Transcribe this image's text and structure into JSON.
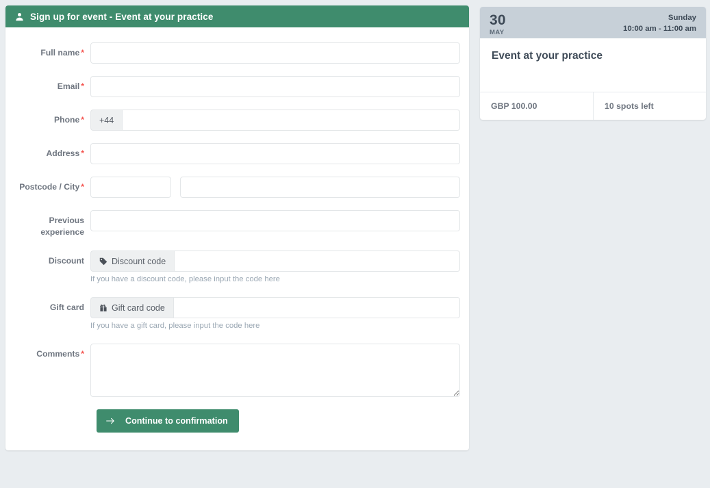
{
  "form": {
    "header": {
      "icon": "user-icon",
      "title": "Sign up for event - Event at your practice"
    },
    "fields": {
      "full_name": {
        "label": "Full name",
        "required": "*",
        "value": "",
        "placeholder": ""
      },
      "email": {
        "label": "Email",
        "required": "*",
        "value": "",
        "placeholder": ""
      },
      "phone": {
        "label": "Phone",
        "required": "*",
        "prefix": "+44",
        "value": "",
        "placeholder": ""
      },
      "address": {
        "label": "Address",
        "required": "*",
        "value": "",
        "placeholder": ""
      },
      "postcode_city": {
        "label": "Postcode / City",
        "required": "*",
        "postcode_value": "",
        "postcode_placeholder": "",
        "city_value": "",
        "city_placeholder": ""
      },
      "previous_experience": {
        "label": "Previous experience",
        "value": "",
        "placeholder": ""
      },
      "discount": {
        "label": "Discount",
        "addon_icon": "tag-icon",
        "addon_label": "Discount code",
        "value": "",
        "placeholder": "",
        "help": "If you have a discount code, please input the code here"
      },
      "gift_card": {
        "label": "Gift card",
        "addon_icon": "gift-icon",
        "addon_label": "Gift card code",
        "value": "",
        "placeholder": "",
        "help": "If you have a gift card, please input the code here"
      },
      "comments": {
        "label": "Comments",
        "required": "*",
        "value": "",
        "placeholder": ""
      }
    },
    "submit": {
      "icon": "arrow-right-icon",
      "label": "Continue to confirmation"
    }
  },
  "event_card": {
    "day": "30",
    "month": "MAY",
    "weekday": "Sunday",
    "time": "10:00 am - 11:00 am",
    "title": "Event at your practice",
    "price": "GBP 100.00",
    "spots": "10 spots left"
  },
  "colors": {
    "accent_green": "#3f8c6d",
    "required_red": "#f4524d",
    "page_background": "#e9edf0",
    "event_head": "#c7d0d8",
    "label_grey": "#6f7680",
    "help_grey": "#9aa7b3"
  }
}
